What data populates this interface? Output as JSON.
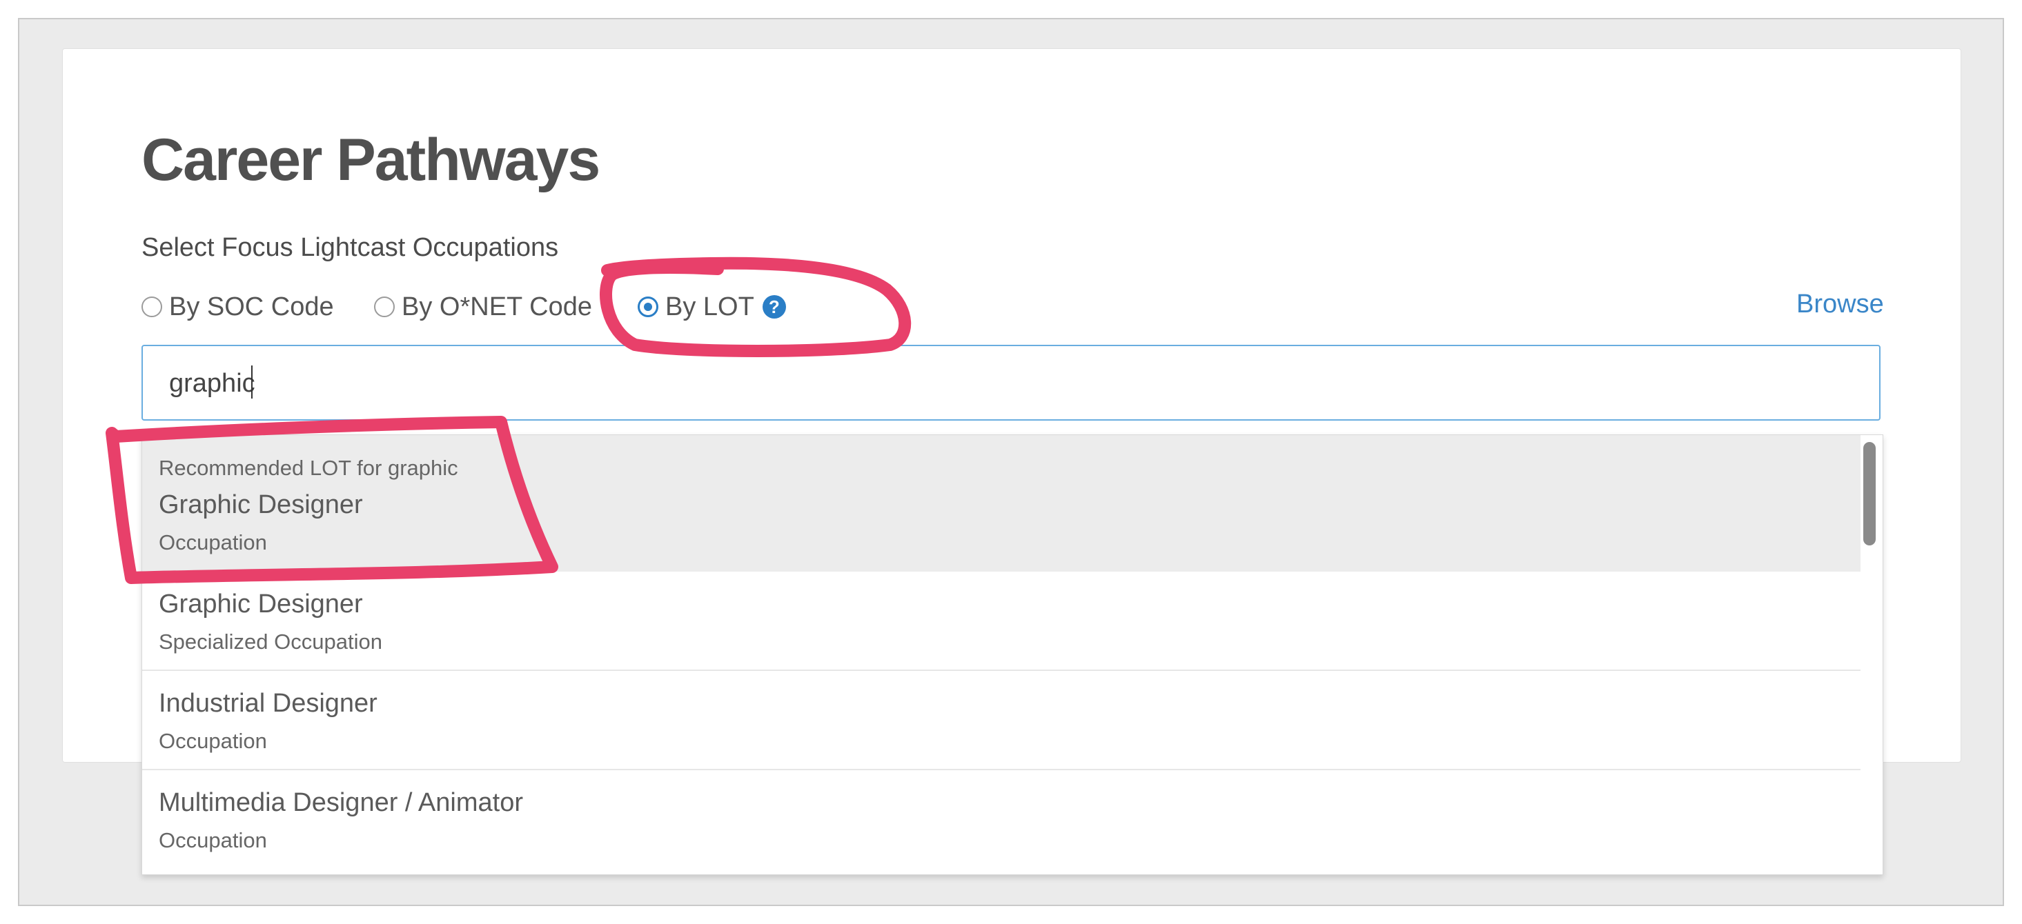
{
  "page": {
    "title": "Career Pathways",
    "subtitle": "Select Focus Lightcast Occupations"
  },
  "options": [
    {
      "label": "By SOC Code",
      "checked": false
    },
    {
      "label": "By O*NET Code",
      "checked": false
    },
    {
      "label": "By LOT",
      "checked": true
    }
  ],
  "help_icon_glyph": "?",
  "browse_label": "Browse",
  "search": {
    "value": "graphic"
  },
  "dropdown": {
    "items": [
      {
        "group": "Recommended LOT for graphic",
        "name": "Graphic Designer",
        "type": "Occupation",
        "highlighted": true
      },
      {
        "name": "Graphic Designer",
        "type": "Specialized Occupation"
      },
      {
        "name": "Industrial Designer",
        "type": "Occupation"
      },
      {
        "name": "Multimedia Designer / Animator",
        "type": "Occupation"
      }
    ]
  },
  "colors": {
    "accent": "#2a7ec6",
    "annotation": "#e8406a",
    "highlight_row": "#ececec"
  }
}
